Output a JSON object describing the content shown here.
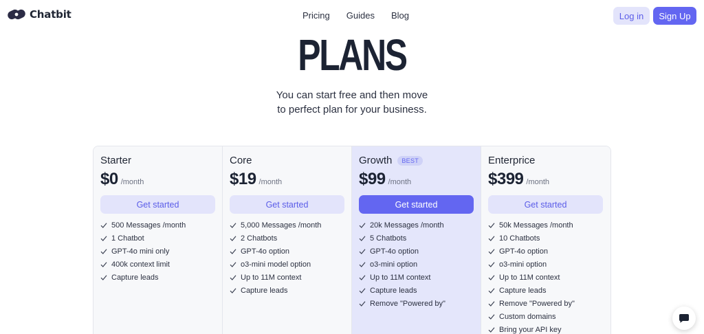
{
  "header": {
    "logo_text": "Chatbit",
    "logo_icon": "chatbit-logo-icon",
    "nav": [
      "Pricing",
      "Guides",
      "Blog"
    ],
    "login_label": "Log in",
    "signup_label": "Sign Up"
  },
  "hero": {
    "title": "PLANS",
    "subtitle_line1": "You can start free and then move",
    "subtitle_line2": "to perfect plan for your business."
  },
  "colors": {
    "accent": "#6366f1",
    "accent_light": "#e3e4fb",
    "featured_bg": "#e4e6fb",
    "card_bg": "#f7f8fa"
  },
  "plans": [
    {
      "name": "Starter",
      "price": "$0",
      "period": "/month",
      "cta": "Get started",
      "features": [
        "500 Messages /month",
        "1 Chatbot",
        "GPT-4o mini only",
        "400k context limit",
        "Capture leads"
      ]
    },
    {
      "name": "Core",
      "price": "$19",
      "period": "/month",
      "cta": "Get started",
      "features": [
        "5,000 Messages /month",
        "2 Chatbots",
        "GPT-4o option",
        "o3-mini model option",
        "Up to 11M context",
        "Capture leads"
      ]
    },
    {
      "name": "Growth",
      "badge": "BEST",
      "price": "$99",
      "period": "/month",
      "cta": "Get started",
      "features": [
        "20k Messages /month",
        "5 Chatbots",
        "GPT-4o option",
        "o3-mini option",
        "Up to 11M context",
        "Capture leads",
        "Remove \"Powered by\""
      ]
    },
    {
      "name": "Enterprice",
      "price": "$399",
      "period": "/month",
      "cta": "Get started",
      "features": [
        "50k Messages /month",
        "10 Chatbots",
        "GPT-4o option",
        "o3-mini option",
        "Up to 11M context",
        "Capture leads",
        "Remove \"Powered by\"",
        "Custom domains",
        "Bring your API key"
      ]
    }
  ],
  "chat_widget": {
    "icon": "chat-bubble-icon"
  }
}
